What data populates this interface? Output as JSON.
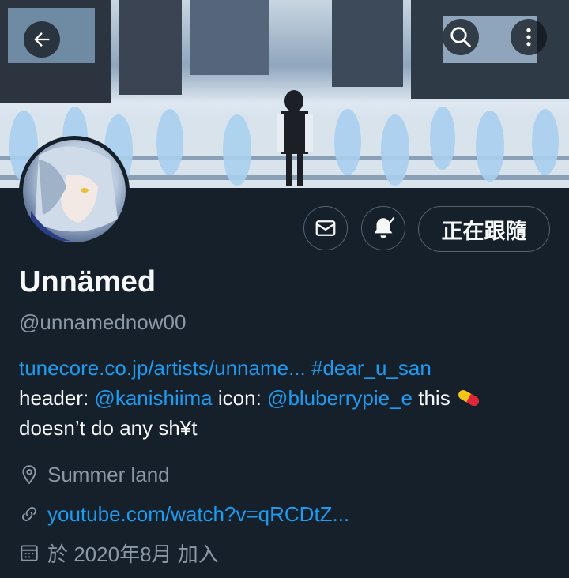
{
  "header": {
    "back_icon": "arrow-left-icon",
    "search_icon": "search-icon",
    "more_icon": "more-vertical-icon"
  },
  "profile": {
    "display_name": "Unnämed",
    "handle": "@unnamednow00",
    "follow_button_label": "正在跟隨",
    "message_icon": "envelope-icon",
    "notify_icon": "bell-check-icon"
  },
  "bio": {
    "link_text": "tunecore.co.jp/artists/unname...",
    "hashtag": "#dear_u_san",
    "header_label": "header:",
    "header_mention": "@kanishiima",
    "icon_label": "icon:",
    "icon_mention": "@bluberrypie_e",
    "tail_text": "this",
    "pill_icon": "pill-emoji",
    "line2": "doesn’t do any sh¥t"
  },
  "meta": {
    "location": "Summer land",
    "website": "youtube.com/watch?v=qRCDtZ...",
    "joined": "於 2020年8月 加入"
  },
  "colors": {
    "background": "#15202b",
    "link": "#1d9bf0",
    "secondary_text": "#8b98a5",
    "border": "#536471"
  }
}
